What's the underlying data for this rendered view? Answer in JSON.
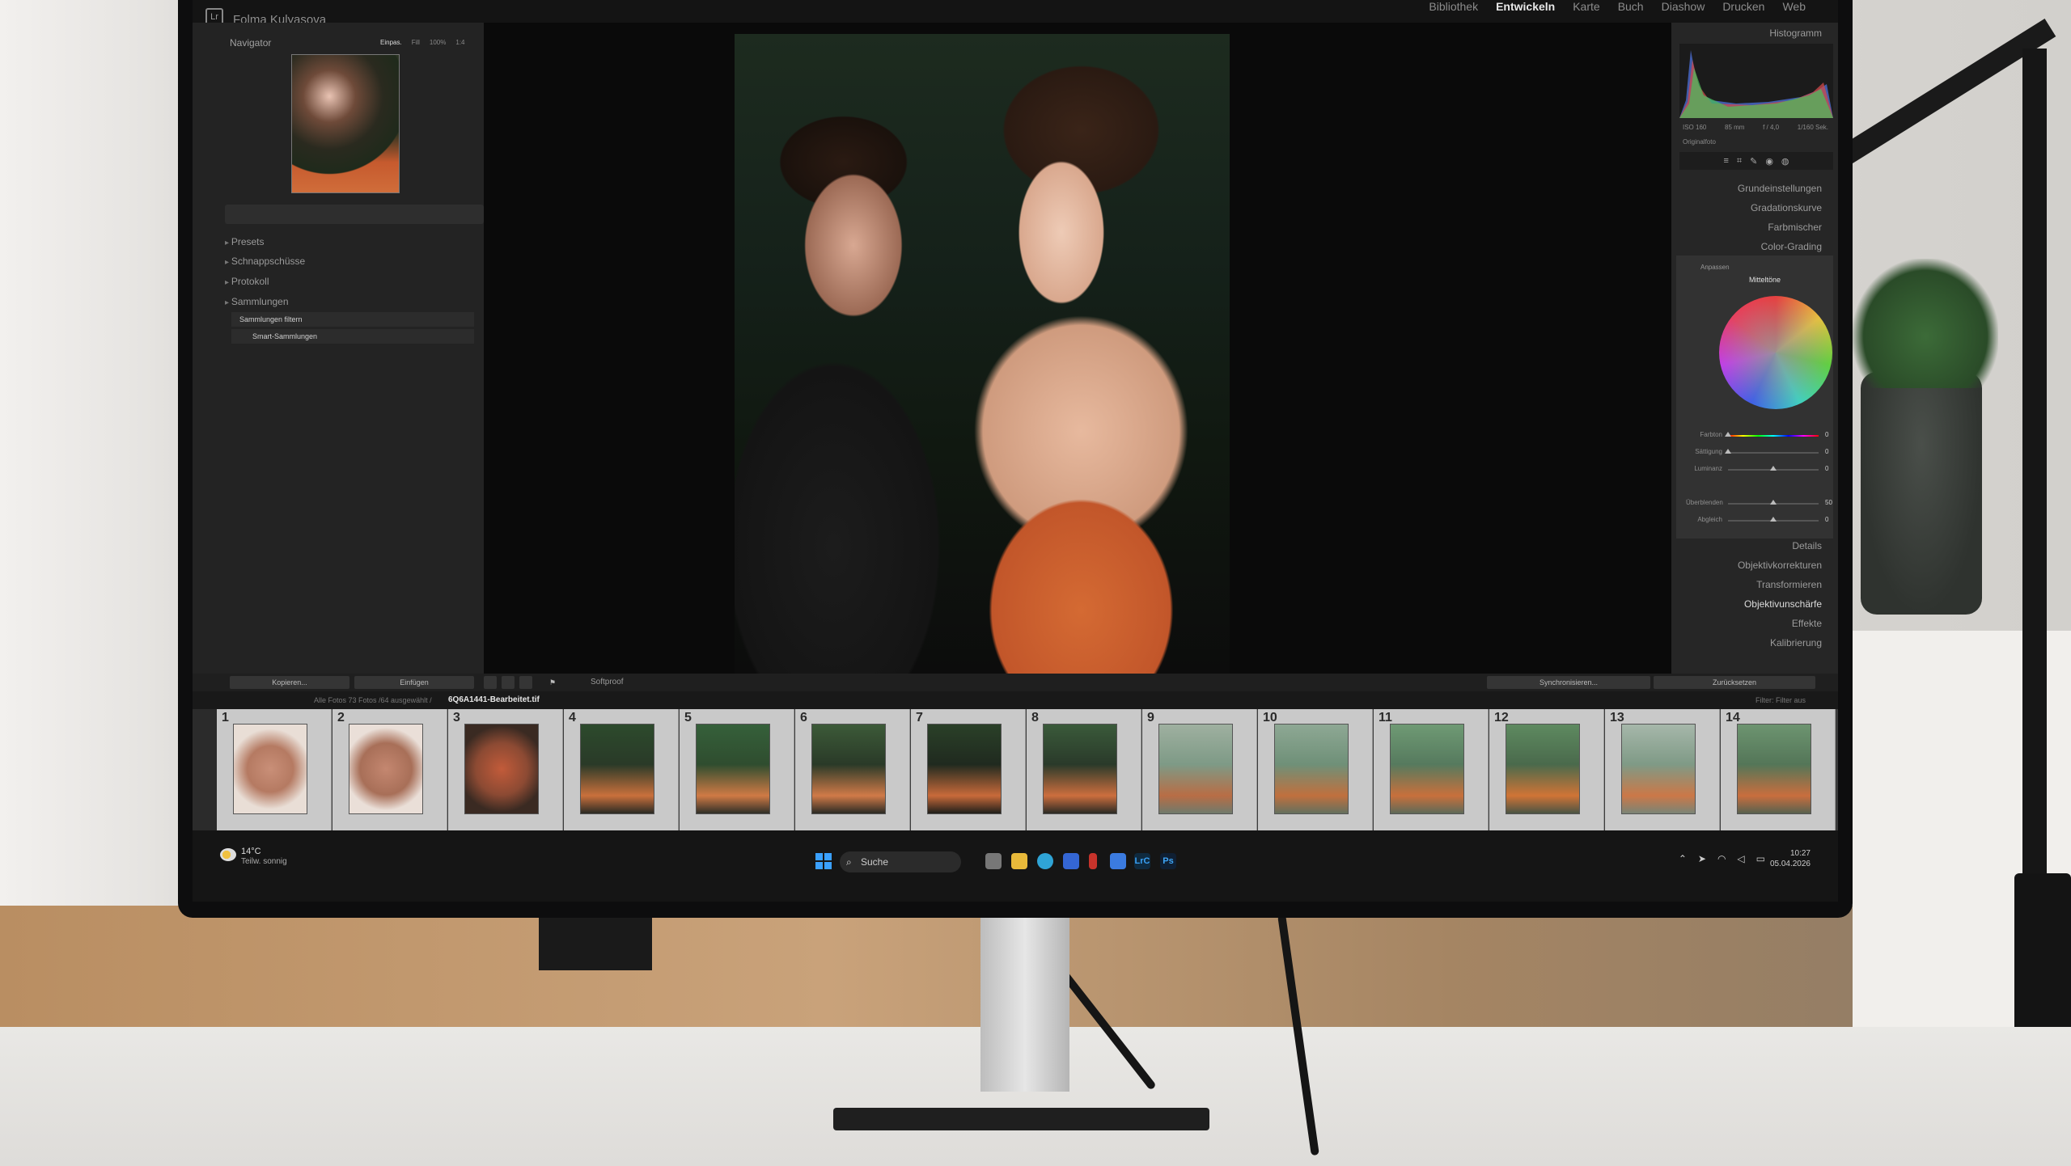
{
  "app": {
    "identity_plate": "Folma Kulyasova",
    "logo_text": "LrC",
    "modules": [
      "Bibliothek",
      "Entwickeln",
      "Karte",
      "Buch",
      "Diashow",
      "Drucken",
      "Web"
    ],
    "active_module": "Entwickeln"
  },
  "left_panel": {
    "navigator_label": "Navigator",
    "zoom_options": [
      "Einpas.",
      "Fill",
      "100%",
      "1:4"
    ],
    "sections": [
      "Presets",
      "Schnappschüsse",
      "Protokoll",
      "Sammlungen"
    ],
    "collections": [
      "Sammlungen filtern",
      "Smart-Sammlungen"
    ]
  },
  "right_panel": {
    "histogram_label": "Histogramm",
    "hist_info": {
      "iso": "ISO 160",
      "focal": "85 mm",
      "aperture": "f / 4,0",
      "shutter": "1/160 Sek."
    },
    "original_label": "Originalfoto",
    "panels_top": [
      "Grundeinstellungen",
      "Gradationskurve",
      "Farbmischer",
      "Color-Grading"
    ],
    "color_grading": {
      "adjust_label": "Anpassen",
      "mode": "Mitteltöne",
      "sliders": [
        {
          "label": "Farbton",
          "value": "0",
          "position": 0.0
        },
        {
          "label": "Sättigung",
          "value": "0",
          "position": 0.0
        },
        {
          "label": "Luminanz",
          "value": "0",
          "position": 0.5
        },
        {
          "label": "Überblenden",
          "value": "50",
          "position": 0.5
        },
        {
          "label": "Abgleich",
          "value": "0",
          "position": 0.5
        }
      ]
    },
    "panels_bottom": [
      "Details",
      "Objektivkorrekturen",
      "Transformieren",
      "Objektivunschärfe",
      "Effekte",
      "Kalibrierung"
    ],
    "highlighted_panel": "Objektivunschärfe"
  },
  "toolbar": {
    "copy_label": "Kopieren...",
    "paste_label": "Einfügen",
    "softproof_label": "Softproof",
    "sync_label": "Synchronisieren...",
    "reset_label": "Zurücksetzen"
  },
  "filmstrip": {
    "source_text": "Alle Fotos  73 Fotos /64 ausgewählt /",
    "selected_file": "6Q6A1441-Bearbeitet.tif",
    "filter_label": "Filter:",
    "filter_value": "Filter aus",
    "numbers": [
      "1",
      "2",
      "3",
      "4",
      "5",
      "6",
      "7",
      "8",
      "9",
      "10",
      "11",
      "12",
      "13",
      "14"
    ]
  },
  "taskbar": {
    "weather_temp": "14°C",
    "weather_desc": "Teilw. sonnig",
    "search_label": "Suche",
    "lrc_label": "LrC",
    "ps_label": "Ps",
    "time": "10:27",
    "date": "05.04.2026"
  },
  "colors": {
    "accent_lr": "#3aa0ff",
    "skirt_orange": "#d06d3a",
    "screen_bg": "#2b2b2b"
  }
}
